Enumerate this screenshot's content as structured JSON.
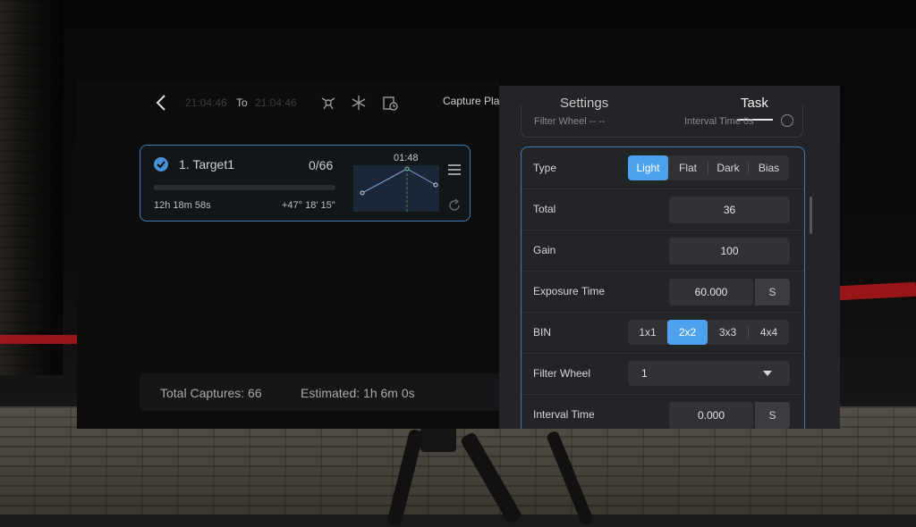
{
  "plan": {
    "time_from": "21:04:46",
    "to_label": "To",
    "time_to": "21:04:46",
    "title": "Capture Plan",
    "target": {
      "name": "1. Target1",
      "count": "0/66",
      "progress": 0,
      "duration": "12h 18m 58s",
      "coord": "+47° 18' 15\"",
      "chart_time": "01:48"
    },
    "summary": {
      "total_captures": "Total Captures: 66",
      "estimated": "Estimated: 1h 6m 0s"
    }
  },
  "settings": {
    "tabs": {
      "settings": "Settings",
      "task": "Task"
    },
    "prev_card": {
      "filter": "Filter Wheel -- --",
      "interval": "Interval Time 0s"
    },
    "type": {
      "label": "Type",
      "options": [
        "Light",
        "Flat",
        "Dark",
        "Bias"
      ],
      "selected": "Light"
    },
    "total": {
      "label": "Total",
      "value": "36"
    },
    "gain": {
      "label": "Gain",
      "value": "100"
    },
    "exposure": {
      "label": "Exposure Time",
      "value": "60.000",
      "unit": "S"
    },
    "bin": {
      "label": "BIN",
      "options": [
        "1x1",
        "2x2",
        "3x3",
        "4x4"
      ],
      "selected": "2x2"
    },
    "filter_wheel": {
      "label": "Filter Wheel",
      "value": "1"
    },
    "interval": {
      "label": "Interval Time",
      "value": "0.000",
      "unit": "S"
    }
  },
  "colors": {
    "accent": "#4da2ee",
    "card_border": "#3d7ab8"
  },
  "icons": [
    "back-icon",
    "mount-icon",
    "snowflake-icon",
    "schedule-icon",
    "check-icon",
    "menu-icon",
    "refresh-icon",
    "caret-down-icon"
  ]
}
